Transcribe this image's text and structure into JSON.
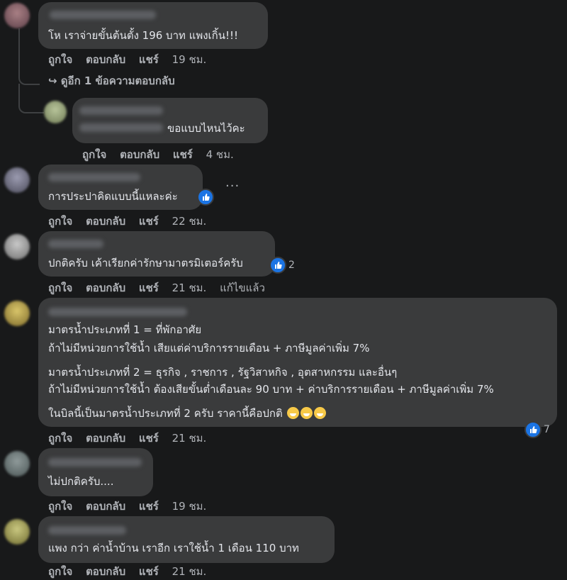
{
  "labels": {
    "like": "ถูกใจ",
    "reply": "ตอบกลับ",
    "share": "แชร์"
  },
  "colors": {
    "background": "#18191a",
    "bubble": "#3a3b3c",
    "secondary_text": "#b0b3b8",
    "like_blue": "#1b74e4"
  },
  "comments": [
    {
      "text": "โห เราจ่ายขั้นต้นตั้ง 196 บาท แพงเกิ้น!!!",
      "time": "19 ชม."
    },
    {
      "view_more": "ดูอีก 1 ข้อความตอบกลับ"
    },
    {
      "text": "ขอแบบไหนไว้คะ",
      "time": "4 ชม."
    },
    {
      "text": "การประปาคิดแบบนี้แหละค่ะ",
      "time": "22 ชม."
    },
    {
      "text": "ปกติครับ เค้าเรียกค่ารักษามาตรมิเตอร์ครับ",
      "time": "21 ชม.",
      "reactions": "2",
      "edited": "แก้ไขแล้ว"
    },
    {
      "lines": [
        "มาตรน้ำประเภทที่ 1 = ที่พักอาศัย",
        "ถ้าไม่มีหน่วยการใช้น้ำ เสียแต่ค่าบริการรายเดือน + ภาษีมูลค่าเพิ่ม 7%",
        "มาตรน้ำประเภทที่ 2 = ธุรกิจ , ราชการ , รัฐวิสาหกิจ , อุตสาหกรรม และอื่นๆ",
        "ถ้าไม่มีหน่วยการใช้น้ำ ต้องเสียขั้นต่ำเดือนละ 90 บาท + ค่าบริการรายเดือน + ภาษีมูลค่าเพิ่ม 7%",
        "ในบิลนี้เป็นมาตรน้ำประเภทที่ 2 ครับ ราคานี้คือปกติ"
      ],
      "time": "21 ชม.",
      "reactions": "7"
    },
    {
      "text": "ไม่ปกติครับ....",
      "time": "19 ชม."
    },
    {
      "text": "แพง กว่า ค่าน้ำบ้าน เราอีก เราใช้น้ำ 1 เดือน 110 บาท",
      "time": "21 ชม."
    }
  ]
}
